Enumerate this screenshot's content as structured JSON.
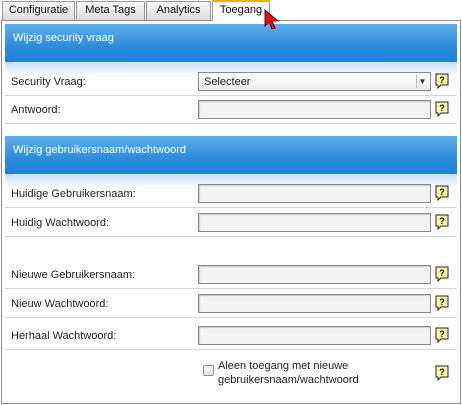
{
  "tabs": [
    {
      "label": "Configuratie",
      "active": false
    },
    {
      "label": "Meta Tags",
      "active": false
    },
    {
      "label": "Analytics",
      "active": false
    },
    {
      "label": "Toegang",
      "active": true
    }
  ],
  "sections": {
    "security": {
      "title": "Wijzig security vraag",
      "question_label": "Security Vraag:",
      "question_value": "Selecteer",
      "answer_label": "Antwoord:"
    },
    "credentials": {
      "title": "Wijzig gebruikersnaam/wachtwoord",
      "current_username_label": "Huidige Gebruikersnaam:",
      "current_password_label": "Huidig Wachtwoord:",
      "new_username_label": "Nieuwe Gebruikersnaam:",
      "new_password_label": "Nieuw Wachtwoord:",
      "repeat_password_label": "Herhaal Wachtwoord:",
      "checkbox_label": "Aleen toegang met nieuwe gebruikersnaam/wachtwoord",
      "checkbox_checked": false
    }
  },
  "colors": {
    "section_header": "#2f8ede",
    "active_tab_accent": "#f0b400"
  },
  "icons": {
    "help": "help-speech-bubble-icon",
    "cursor": "mouse-pointer-icon"
  }
}
